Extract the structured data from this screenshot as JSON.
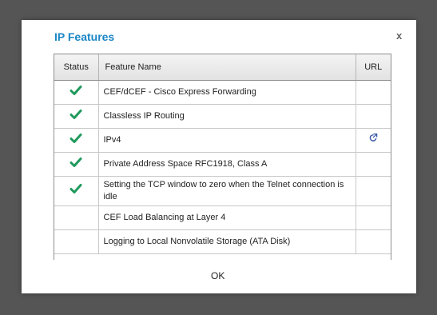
{
  "dialog": {
    "title": "IP Features",
    "close_label": "x",
    "ok_label": "OK",
    "accent_color": "#1a86c7",
    "check_color": "#1f9a5c"
  },
  "table": {
    "headers": {
      "status": "Status",
      "feature": "Feature Name",
      "url": "URL"
    },
    "rows": [
      {
        "status": "check",
        "feature": "CEF/dCEF - Cisco Express Forwarding",
        "url": ""
      },
      {
        "status": "check",
        "feature": "Classless IP Routing",
        "url": ""
      },
      {
        "status": "check",
        "feature": "IPv4",
        "url": "external-link-icon"
      },
      {
        "status": "check",
        "feature": "Private Address Space RFC1918, Class A",
        "url": ""
      },
      {
        "status": "check",
        "feature": "Setting the TCP window to zero when the Telnet connection is idle",
        "url": ""
      },
      {
        "status": "",
        "feature": "CEF Load Balancing at Layer 4",
        "url": ""
      },
      {
        "status": "",
        "feature": "Logging to Local Nonvolatile Storage (ATA Disk)",
        "url": ""
      }
    ]
  }
}
